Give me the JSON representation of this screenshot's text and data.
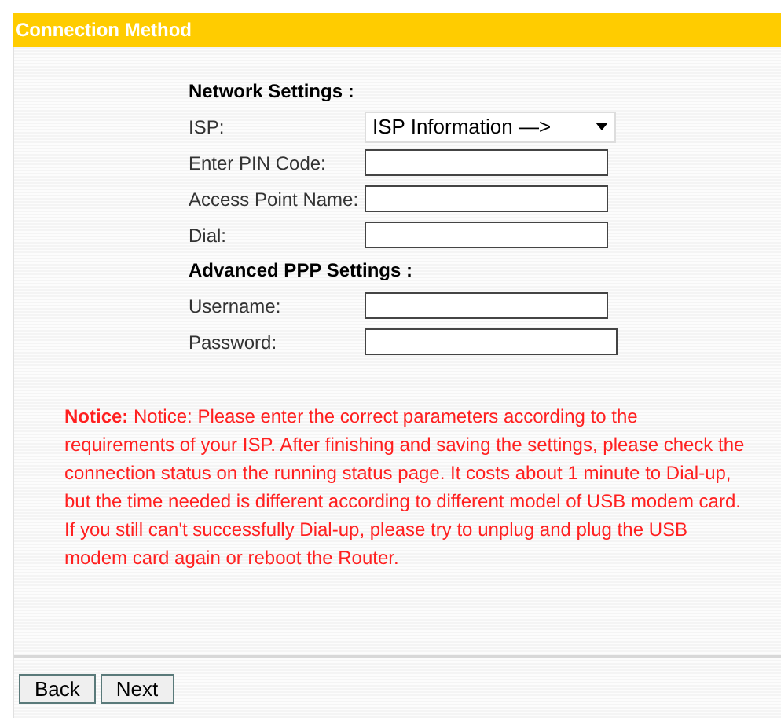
{
  "header": {
    "title": "Connection Method"
  },
  "sections": [
    {
      "heading": "Network Settings :",
      "fields": [
        {
          "kind": "select",
          "label": "ISP:",
          "value": "ISP Information —>"
        },
        {
          "kind": "text",
          "label": "Enter PIN Code:"
        },
        {
          "kind": "text",
          "label": "Access Point Name:"
        },
        {
          "kind": "text",
          "label": "Dial:"
        }
      ]
    },
    {
      "heading": "Advanced PPP Settings :",
      "fields": [
        {
          "kind": "text",
          "label": "Username:"
        },
        {
          "kind": "password",
          "label": "Password:"
        }
      ]
    }
  ],
  "notice": {
    "text": "**Notice:** Notice: Please enter the correct parameters according to the requirements of your ISP. After finishing and saving the settings, please check the connection status on the running status page. It costs about 1 minute to Dial-up, but the time needed is different according to different model of USB modem card. If you still can't successfully Dial-up, please try to unplug and plug the USB modem card again or reboot the Router."
  },
  "buttons": [
    "Back",
    "Next"
  ]
}
